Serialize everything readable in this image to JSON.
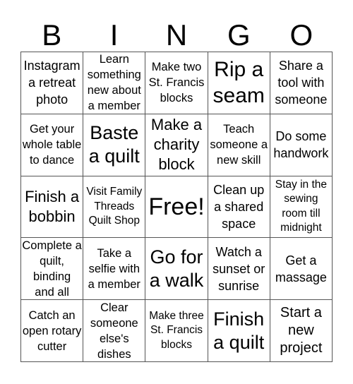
{
  "header": {
    "letters": [
      "B",
      "I",
      "N",
      "G",
      "O"
    ]
  },
  "cells": [
    [
      "Instagram a retreat photo",
      "Learn something new about a member",
      "Make two St. Francis blocks",
      "Rip a seam",
      "Share a tool with someone"
    ],
    [
      "Get your whole table to dance",
      "Baste a quilt",
      "Make a charity block",
      "Teach someone a new skill",
      "Do some handwork"
    ],
    [
      "Finish a bobbin",
      "Visit Family Threads Quilt Shop",
      "Free!",
      "Clean up a shared space",
      "Stay in the sewing room till midnight"
    ],
    [
      "Complete a quilt, binding and all",
      "Take a selfie with a member",
      "Go for a walk",
      "Watch a sunset or sunrise",
      "Get a massage"
    ],
    [
      "Catch an open rotary cutter",
      "Clear someone else's dishes",
      "Make three St. Francis blocks",
      "Finish a quilt",
      "Start a new project"
    ]
  ]
}
